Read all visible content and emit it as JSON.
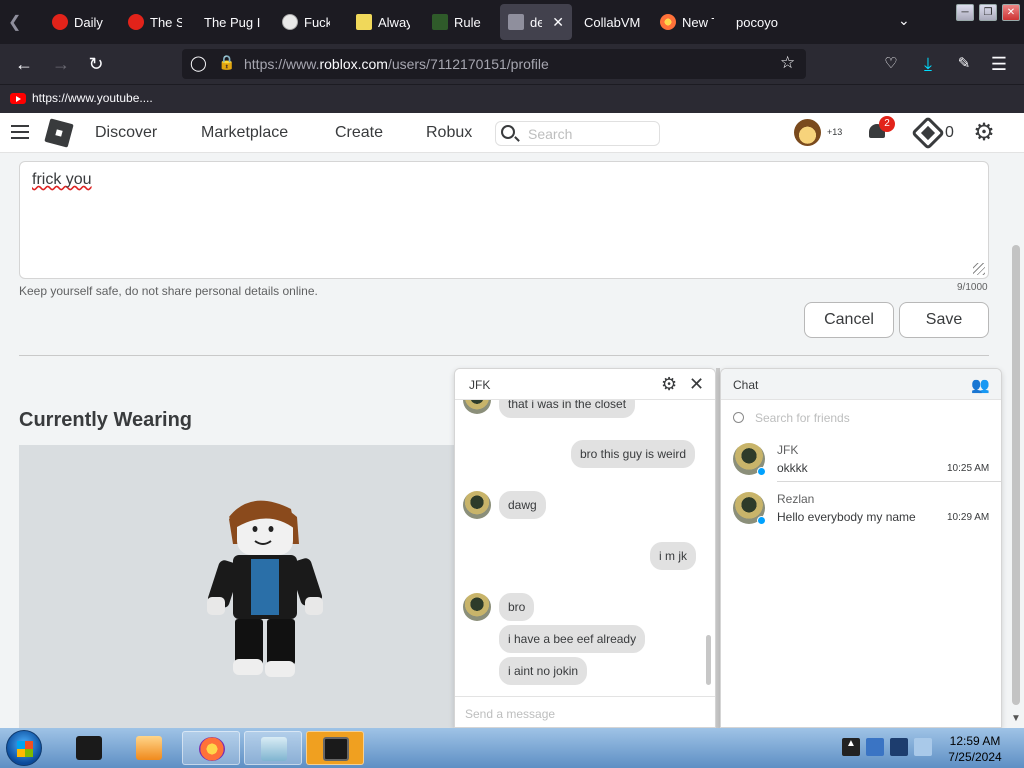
{
  "browser": {
    "tabs": [
      {
        "label": "Daily",
        "icon": "tomato-icon",
        "color": "#e2231a"
      },
      {
        "label": "The S",
        "icon": "tomato-icon",
        "color": "#e2231a"
      },
      {
        "label": "The Pug I",
        "icon": "",
        "color": ""
      },
      {
        "label": "Fuck",
        "icon": "nw-icon",
        "color": "#e9e9e9"
      },
      {
        "label": "Alway",
        "icon": "note-icon",
        "color": "#f0d85a"
      },
      {
        "label": "Rule",
        "icon": "rule34-icon",
        "color": "#2f5b2a"
      },
      {
        "label": "dej",
        "icon": "roblox-icon",
        "color": "#8f8f9d"
      },
      {
        "label": "CollabVM",
        "icon": "",
        "color": ""
      },
      {
        "label": "New T",
        "icon": "firefox-icon",
        "color": "#ff7139"
      },
      {
        "label": "pocoyo",
        "icon": "",
        "color": ""
      }
    ],
    "url_prefix": "https://www.",
    "url_domain": "roblox.com",
    "url_path": "/users/7112170151/profile",
    "bookmark_label": "https://www.youtube...."
  },
  "roblox": {
    "nav": [
      "Discover",
      "Marketplace",
      "Create",
      "Robux"
    ],
    "search_placeholder": "Search",
    "friend_count": "13",
    "notification_count": "2",
    "robux_balance": "0"
  },
  "profile": {
    "about_text": "frick you",
    "safety_note": "Keep yourself safe, do not share personal details online.",
    "char_count": "9/1000",
    "cancel_label": "Cancel",
    "save_label": "Save",
    "wearing_title": "Currently Wearing"
  },
  "chat_window": {
    "title": "JFK",
    "input_placeholder": "Send a message",
    "messages": [
      {
        "from": "them",
        "text": "that i was in the closet"
      },
      {
        "from": "me",
        "text": "bro this guy is weird"
      },
      {
        "from": "them",
        "text": "dawg"
      },
      {
        "from": "me",
        "text": "i m jk"
      },
      {
        "from": "them",
        "text": "bro"
      },
      {
        "from": "them",
        "text": "i have a bee eef already"
      },
      {
        "from": "them",
        "text": "i aint no jokin"
      }
    ]
  },
  "chat_list": {
    "title": "Chat",
    "search_placeholder": "Search for friends",
    "conversations": [
      {
        "name": "JFK",
        "last": "okkkk",
        "time": "10:25 AM"
      },
      {
        "name": "Rezlan",
        "last": "Hello everybody my name",
        "time": "10:29 AM"
      }
    ]
  },
  "taskbar": {
    "time": "12:59 AM",
    "date": "7/25/2024"
  }
}
